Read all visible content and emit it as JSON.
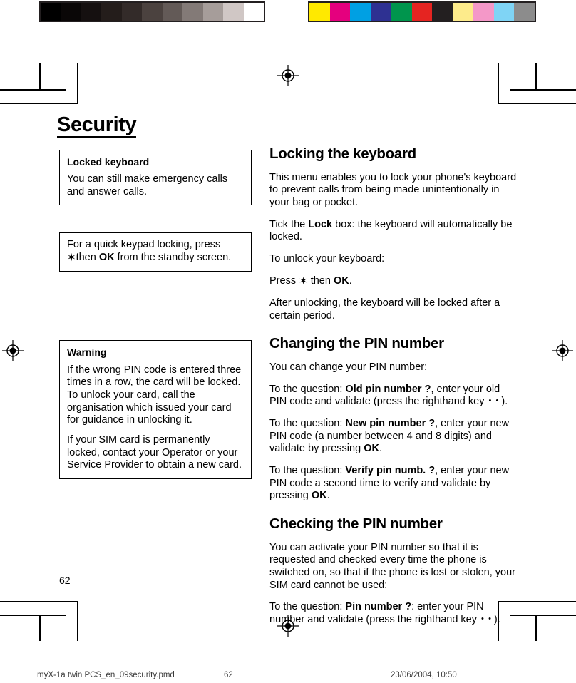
{
  "document": {
    "chapter_title": "Security",
    "page_number": "62"
  },
  "calibration": {
    "grayscale_label": "grayscale-calibration-bar",
    "grayscale_swatches": [
      "#000000",
      "#0a0707",
      "#151010",
      "#241d1b",
      "#332b29",
      "#4b423f",
      "#635a57",
      "#837a77",
      "#a69d9a",
      "#d0c7c5",
      "#ffffff"
    ],
    "color_label": "color-calibration-bar",
    "color_swatches": [
      "#ffe900",
      "#e5007e",
      "#00a0e3",
      "#2e3192",
      "#00954d",
      "#e52421",
      "#231f20",
      "#fdeb8b",
      "#f498c8",
      "#7fd4f5",
      "#8c8c8c"
    ]
  },
  "left_column": {
    "callout_locked_keyboard": {
      "title": "Locked keyboard",
      "body": "You can still make emergency calls and answer calls."
    },
    "callout_quick_lock": {
      "line1_pre": "For a quick  keypad locking, press ",
      "line1_star": "✶",
      "line2_pre": "then ",
      "line2_bold": "OK",
      "line2_post": " from the standby screen."
    },
    "callout_warning": {
      "title": "Warning",
      "paragraph_1": "If the wrong PIN code is entered three times in a row, the card will be locked. To unlock your card, call the organisation which issued your card for guidance in unlocking it.",
      "paragraph_2": "If your SIM card is permanently locked, contact your Operator or your Service Provider to obtain a new card."
    }
  },
  "right_column": {
    "section_locking": {
      "heading": "Locking the keyboard",
      "p1": "This menu enables you to lock your phone's keyboard to prevent calls from being made unintentionally in your bag or pocket.",
      "p2_pre": "Tick the ",
      "p2_bold": "Lock",
      "p2_post": " box: the keyboard will automatically be locked.",
      "p3": "To unlock your keyboard:",
      "p4_pre": "Press ",
      "p4_star": "✶",
      "p4_mid": " then ",
      "p4_bold": "OK",
      "p4_post": ".",
      "p5": "After unlocking, the keyboard will be locked after a certain period."
    },
    "section_changing_pin": {
      "heading": "Changing the PIN number",
      "p1": "You can change your PIN number:",
      "p2_pre": "To the question: ",
      "p2_bold": "Old pin number ?",
      "p2_mid": ", enter your old PIN code and validate (press the righthand key ",
      "p2_key": "• •",
      "p2_post": ").",
      "p3_pre": "To the question: ",
      "p3_bold": "New pin number ?",
      "p3_mid": ", enter your new PIN code (a number between 4 and 8 digits) and validate by pressing ",
      "p3_bold2": "OK",
      "p3_post": ".",
      "p4_pre": "To the question: ",
      "p4_bold": "Verify pin numb. ?",
      "p4_mid": ", enter your new PIN code a second time to verify and validate by pressing ",
      "p4_bold2": "OK",
      "p4_post": "."
    },
    "section_checking_pin": {
      "heading": "Checking the PIN number",
      "p1": "You can activate your PIN number so that it is requested and checked every time the phone is switched on, so that if the phone is lost or stolen, your SIM card cannot be used:",
      "p2_pre": "To the question: ",
      "p2_bold": "Pin number ?",
      "p2_mid": ": enter your PIN number and validate (press the righthand key ",
      "p2_key": "• •",
      "p2_post": ")."
    }
  },
  "footer": {
    "file_name": "myX-1a twin PCS_en_09security.pmd",
    "page_number": "62",
    "timestamp": "23/06/2004, 10:50"
  }
}
